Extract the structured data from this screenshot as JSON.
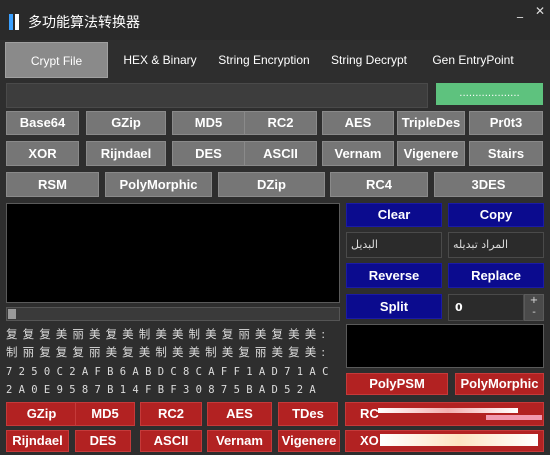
{
  "window": {
    "title": "多功能算法转换器",
    "minimize": "_",
    "close": "✕"
  },
  "tabs": [
    {
      "label": "Crypt File",
      "active": true
    },
    {
      "label": "HEX & Binary"
    },
    {
      "label": "String Encryption"
    },
    {
      "label": "String Decrypt"
    },
    {
      "label": "Gen EntryPoint"
    }
  ],
  "file": {
    "path_value": "",
    "browse_label": "..................."
  },
  "algo_rows": [
    [
      "Base64",
      "GZip",
      "MD5",
      "RC2",
      "AES",
      "TripleDes",
      "Pr0t3"
    ],
    [
      "XOR",
      "Rijndael",
      "DES",
      "ASCII",
      "Vernam",
      "Vigenere",
      "Stairs"
    ],
    [
      "RSM",
      "PolyMorphic",
      "DZip",
      "RC4",
      "3DES"
    ]
  ],
  "string_tools": {
    "clear": "Clear",
    "copy": "Copy",
    "field_left": "البديل",
    "field_right": "المراد تبديله",
    "reverse": "Reverse",
    "replace": "Replace",
    "split": "Split",
    "split_value": "0",
    "stepper_up": "+",
    "stepper_down": "-"
  },
  "char_rows": [
    [
      "复",
      "复",
      "复",
      "美",
      "丽",
      "美",
      "复",
      "美",
      "制",
      "美",
      "美",
      "制",
      "美",
      "复",
      "丽",
      "美",
      "复",
      "美",
      "美",
      ":"
    ],
    [
      "制",
      "丽",
      "复",
      "复",
      "复",
      "丽",
      "美",
      "复",
      "美",
      "制",
      "美",
      "美",
      "制",
      "美",
      "复",
      "丽",
      "美",
      "复",
      "美",
      ":"
    ]
  ],
  "hex_rows": [
    "7 2 5 0 C 2 A F B 6 A B D C 8 C A F F 1 A D 7 1 A C",
    "2 A 0 E 9 5 8 7 B 1 4 F B F 3 0 8 7 5 B A D 5 2 A"
  ],
  "poly": {
    "psm": "PolyPSM",
    "morphic": "PolyMorphic"
  },
  "bottom_rows": [
    [
      "GZip",
      "MD5",
      "RC2",
      "AES",
      "TDes",
      "RC"
    ],
    [
      "Rijndael",
      "DES",
      "ASCII",
      "Vernam",
      "Vigenere",
      "XO"
    ]
  ],
  "colors": {
    "green": "#5ec27e",
    "blue": "#0b0b8e",
    "red": "#b22222",
    "gray": "#767676",
    "accent": "#3aa0ff"
  }
}
